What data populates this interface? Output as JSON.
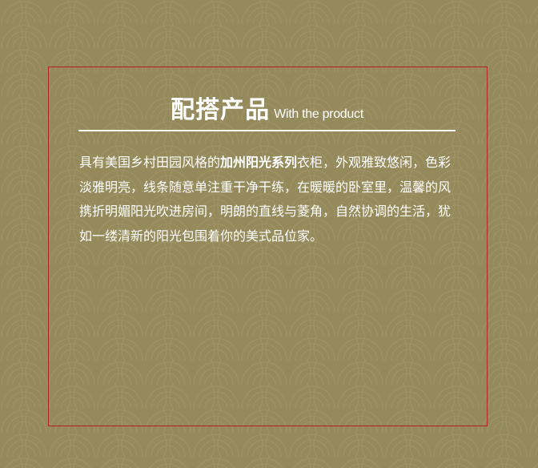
{
  "heading": {
    "chinese": "配搭产品",
    "english": "With the product"
  },
  "description": {
    "before": "具有美国乡村田园风格的",
    "highlight": "加州阳光系列",
    "after": "衣柜，外观雅致悠闲，色彩淡雅明亮，线条随意单注重干净干练，在暖暖的卧室里，温馨的风携折明媚阳光吹进房间，明朗的直线与菱角，自然协调的生活，犹如一缕清新的阳光包围着你的美式品位家。"
  },
  "colors": {
    "background": "#958a5b",
    "pattern_line": "#a69c6e",
    "frame_border": "#b3261e",
    "text": "#ffffff"
  }
}
